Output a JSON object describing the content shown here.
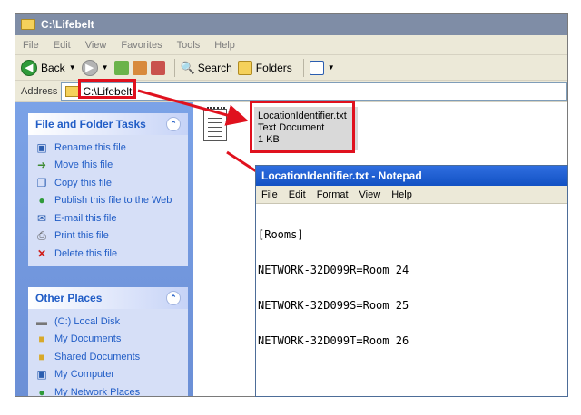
{
  "window": {
    "title": "C:\\Lifebelt"
  },
  "menubar": [
    "File",
    "Edit",
    "View",
    "Favorites",
    "Tools",
    "Help"
  ],
  "toolbar": {
    "back": "Back",
    "search": "Search",
    "folders": "Folders"
  },
  "address": {
    "label": "Address",
    "value": "C:\\Lifebelt"
  },
  "file_tasks": {
    "title": "File and Folder Tasks",
    "items": [
      {
        "label": "Rename this file",
        "icon": "rename-icon"
      },
      {
        "label": "Move this file",
        "icon": "move-icon"
      },
      {
        "label": "Copy this file",
        "icon": "copy-icon"
      },
      {
        "label": "Publish this file to the Web",
        "icon": "globe-icon"
      },
      {
        "label": "E-mail this file",
        "icon": "email-icon"
      },
      {
        "label": "Print this file",
        "icon": "printer-icon"
      },
      {
        "label": "Delete this file",
        "icon": "delete-icon"
      }
    ]
  },
  "other_places": {
    "title": "Other Places",
    "items": [
      {
        "label": "(C:) Local Disk",
        "icon": "disk-icon"
      },
      {
        "label": "My Documents",
        "icon": "folder-icon"
      },
      {
        "label": "Shared Documents",
        "icon": "folder-icon"
      },
      {
        "label": "My Computer",
        "icon": "computer-icon"
      },
      {
        "label": "My Network Places",
        "icon": "network-icon"
      }
    ]
  },
  "file": {
    "name": "LocationIdentifier.txt",
    "type": "Text Document",
    "size": "1 KB"
  },
  "notepad": {
    "title": "LocationIdentifier.txt - Notepad",
    "menu": [
      "File",
      "Edit",
      "Format",
      "View",
      "Help"
    ],
    "lines": [
      "[Rooms]",
      "NETWORK-32D099R=Room 24",
      "NETWORK-32D099S=Room 25",
      "NETWORK-32D099T=Room 26"
    ]
  },
  "colors": {
    "highlight": "#e0111e",
    "link": "#215dc6"
  }
}
